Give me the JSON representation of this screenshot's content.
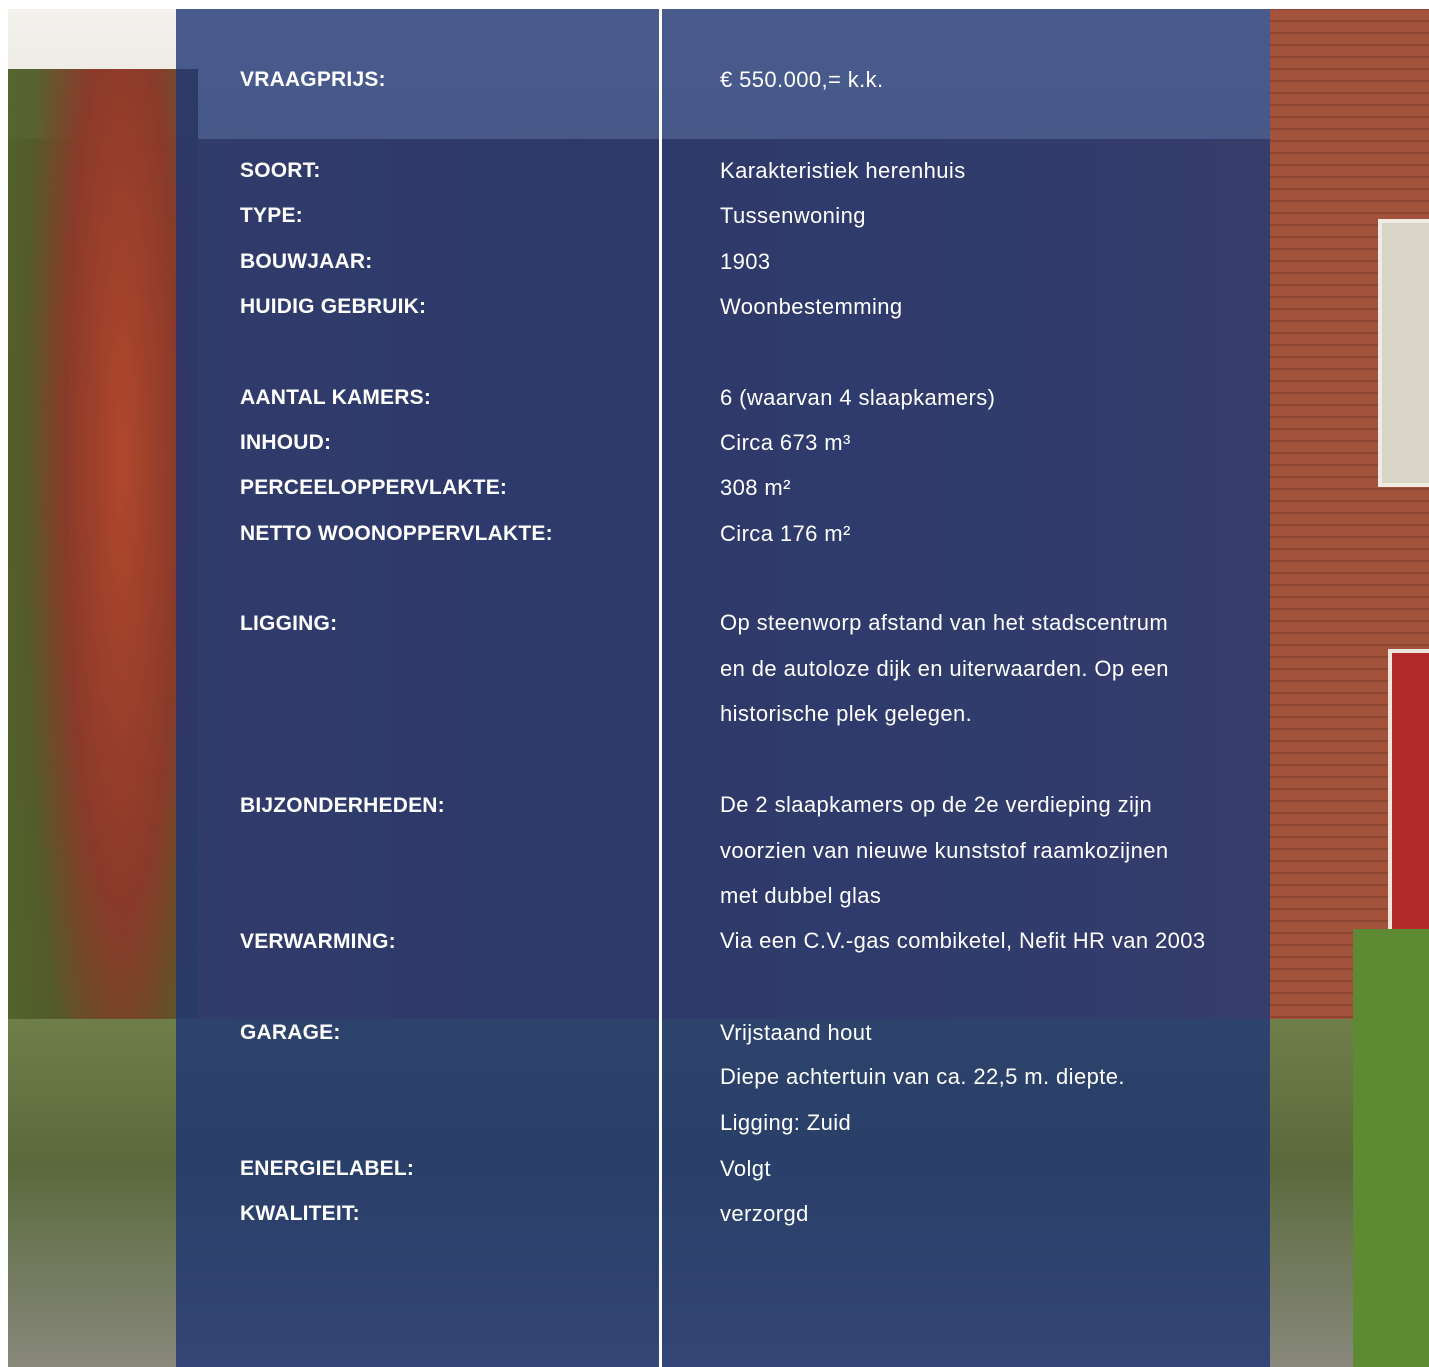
{
  "rows": [
    {
      "label": "VRAAGPRIJS:",
      "value": "€  550.000,= k.k."
    },
    {
      "label": "SOORT:",
      "value": "Karakteristiek herenhuis"
    },
    {
      "label": "TYPE:",
      "value": "Tussenwoning"
    },
    {
      "label": "BOUWJAAR:",
      "value": "1903"
    },
    {
      "label": "HUIDIG GEBRUIK:",
      "value": "Woonbestemming"
    },
    {
      "label": "AANTAL KAMERS:",
      "value": "6 (waarvan 4 slaapkamers)"
    },
    {
      "label": "INHOUD:",
      "value": "Circa 673 m³"
    },
    {
      "label": "PERCEELOPPERVLAKTE:",
      "value": "308 m²"
    },
    {
      "label": "NETTO WOONOPPERVLAKTE:",
      "value": "Circa 176 m²"
    },
    {
      "label": "LIGGING:",
      "value": "Op steenworp afstand van het stadscentrum en de autoloze dijk en uiterwaarden. Op een historische plek gelegen."
    },
    {
      "label": "BIJZONDERHEDEN:",
      "value": "De 2 slaapkamers op de 2e verdieping zijn voorzien van nieuwe kunststof raamkozijnen met dubbel glas"
    },
    {
      "label": "VERWARMING:",
      "value": "Via een C.V.-gas combiketel, Nefit HR van 2003"
    },
    {
      "label": "GARAGE:",
      "value": "Vrijstaand hout"
    },
    {
      "label": "",
      "value": "Diepe achtertuin van ca. 22,5 m. diepte. Ligging: Zuid"
    },
    {
      "label": "ENERGIELABEL:",
      "value": "Volgt"
    },
    {
      "label": "KWALITEIT:",
      "value": "verzorgd"
    }
  ],
  "colors": {
    "panel_overlay": "#1e3474",
    "text": "#ffffff",
    "divider": "#ffffff"
  }
}
